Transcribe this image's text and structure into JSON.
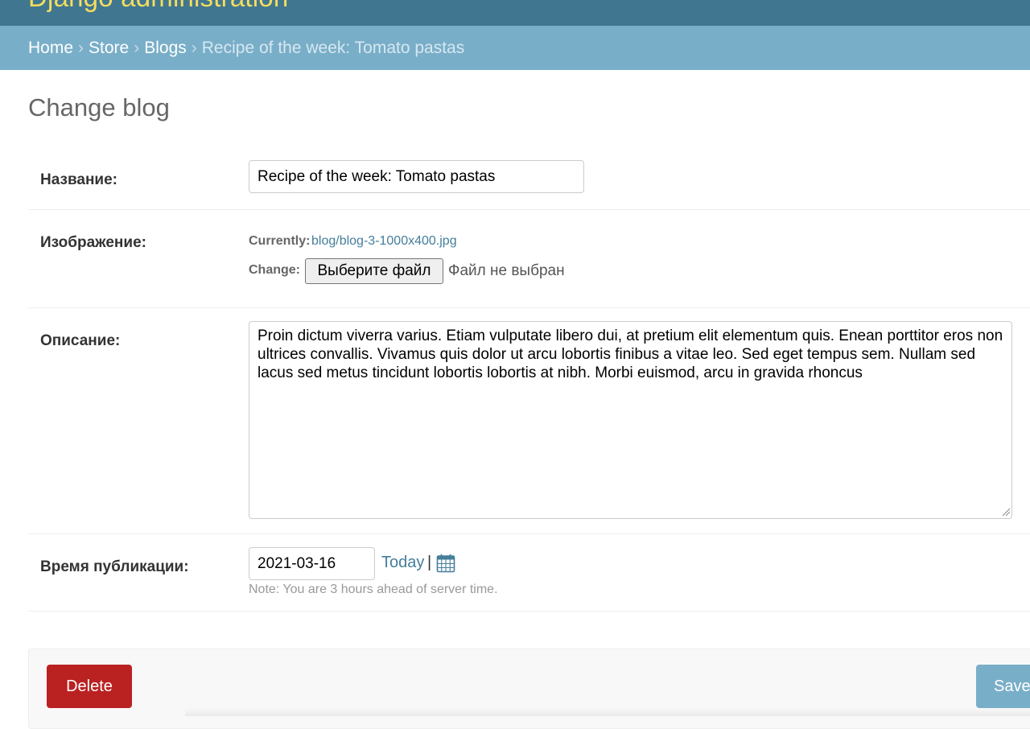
{
  "header": {
    "site_name": "Django administration"
  },
  "breadcrumbs": {
    "items": [
      "Home",
      "Store",
      "Blogs"
    ],
    "separator": "›",
    "current": "Recipe of the week: Tomato pastas"
  },
  "page": {
    "title": "Change blog"
  },
  "form": {
    "name": {
      "label": "Название:",
      "value": "Recipe of the week: Tomato pastas"
    },
    "image": {
      "label": "Изображение:",
      "currently_label": "Currently:",
      "current_file": "blog/blog-3-1000x400.jpg",
      "change_label": "Change:",
      "choose_button": "Выберите файл",
      "no_file_text": "Файл не выбран"
    },
    "description": {
      "label": "Описание:",
      "value": "Proin dictum viverra varius. Etiam vulputate libero dui, at pretium elit elementum quis. Enean porttitor eros non ultrices convallis. Vivamus quis dolor ut arcu lobortis finibus a vitae leo. Sed eget tempus sem. Nullam sed lacus sed metus tincidunt lobortis lobortis at nibh. Morbi euismod, arcu in gravida rhoncus"
    },
    "pub_date": {
      "label": "Время публикации:",
      "value": "2021-03-16",
      "today_link": "Today",
      "separator": "|",
      "calendar_icon": "calendar-icon",
      "note": "Note: You are 3 hours ahead of server time."
    }
  },
  "actions": {
    "delete_label": "Delete",
    "save_label": "Save"
  },
  "colors": {
    "header_bg": "#417690",
    "site_name": "#f5dd5d",
    "breadcrumb_bg": "#79aec8",
    "link": "#447e9b",
    "delete_bg": "#ba2121",
    "save_bg": "#79aec8"
  }
}
